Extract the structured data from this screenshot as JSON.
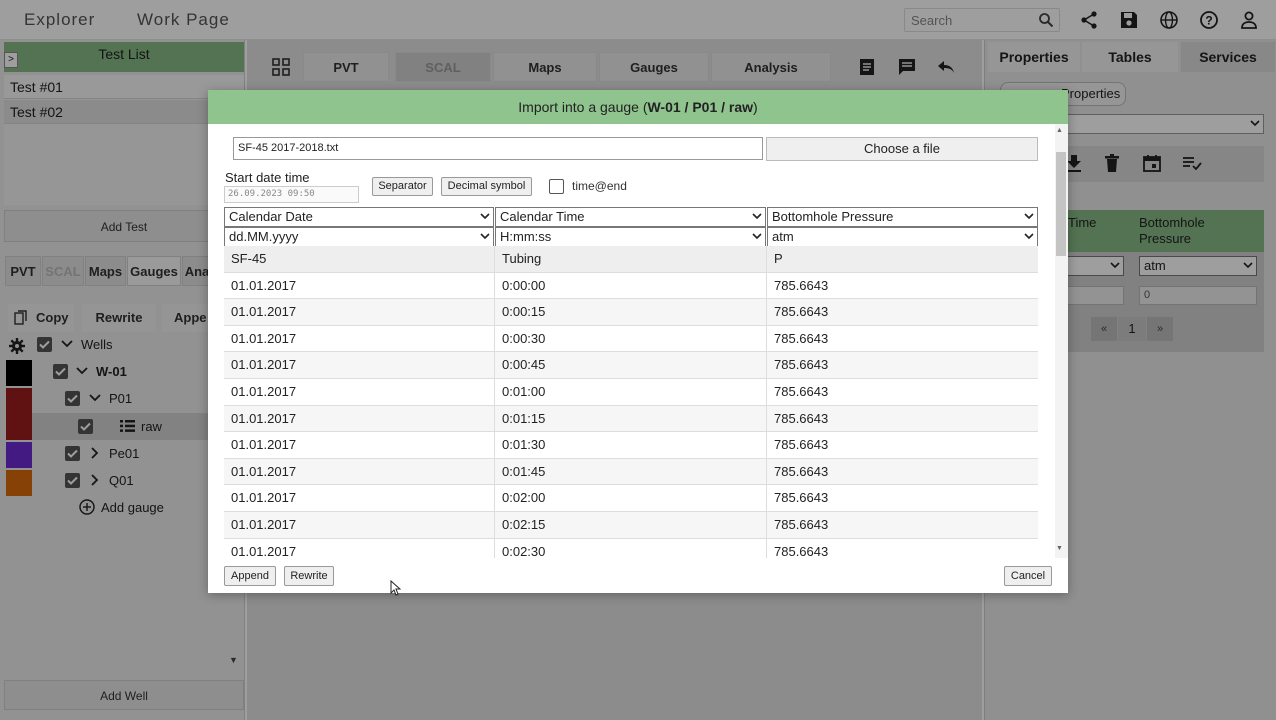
{
  "topbar": {
    "tabs": [
      "Explorer",
      "Work Page"
    ],
    "search_placeholder": "Search"
  },
  "left": {
    "test_list_title": "Test List",
    "tests": [
      "Test #01",
      "Test #02"
    ],
    "add_test": "Add Test",
    "tabs": [
      "PVT",
      "SCAL",
      "Maps",
      "Gauges",
      "Ana"
    ],
    "actions": {
      "copy": "Copy",
      "rewrite": "Rewrite",
      "append": "Appe"
    },
    "tree": {
      "wells": "Wells",
      "well": "W-01",
      "p01": "P01",
      "raw": "raw",
      "pe01": "Pe01",
      "q01": "Q01",
      "add_gauge": "Add gauge"
    },
    "swatch_colors": [
      "#000000",
      "#9b1c1c",
      "#9b1c1c",
      "#6b2bd0",
      "#d96a0b"
    ],
    "add_well": "Add Well"
  },
  "center": {
    "tabs": [
      "PVT",
      "SCAL",
      "Maps",
      "Gauges",
      "Analysis"
    ]
  },
  "right": {
    "tabs": [
      "Properties",
      "Tables",
      "Services"
    ],
    "properties_button": "Properties",
    "col_time": "Time",
    "col_bhp": "Bottomhole Pressure",
    "unit_select": "atm",
    "value_0": "0",
    "pager": {
      "prev": "«",
      "page": "1",
      "next": "»"
    }
  },
  "dialog": {
    "title_prefix": "Import into a gauge (",
    "title_path": "W-01 / P01 / raw",
    "title_suffix": ")",
    "file_name": "SF-45 2017-2018.txt",
    "choose_file": "Choose a file",
    "start_label": "Start date time",
    "start_value": "26.09.2023 09:50",
    "separator": "Separator",
    "decimal": "Decimal symbol",
    "time_end": "time@end",
    "columns": [
      {
        "type": "Calendar Date",
        "format": "dd.MM.yyyy",
        "header": "SF-45"
      },
      {
        "type": "Calendar Time",
        "format": "H:mm:ss",
        "header": "Tubing"
      },
      {
        "type": "Bottomhole Pressure",
        "format": "atm",
        "header": "P"
      }
    ],
    "rows": [
      [
        "01.01.2017",
        "0:00:00",
        "785.6643"
      ],
      [
        "01.01.2017",
        "0:00:15",
        "785.6643"
      ],
      [
        "01.01.2017",
        "0:00:30",
        "785.6643"
      ],
      [
        "01.01.2017",
        "0:00:45",
        "785.6643"
      ],
      [
        "01.01.2017",
        "0:01:00",
        "785.6643"
      ],
      [
        "01.01.2017",
        "0:01:15",
        "785.6643"
      ],
      [
        "01.01.2017",
        "0:01:30",
        "785.6643"
      ],
      [
        "01.01.2017",
        "0:01:45",
        "785.6643"
      ],
      [
        "01.01.2017",
        "0:02:00",
        "785.6643"
      ],
      [
        "01.01.2017",
        "0:02:15",
        "785.6643"
      ],
      [
        "01.01.2017",
        "0:02:30",
        "785.6643"
      ]
    ],
    "append": "Append",
    "rewrite": "Rewrite",
    "cancel": "Cancel"
  }
}
